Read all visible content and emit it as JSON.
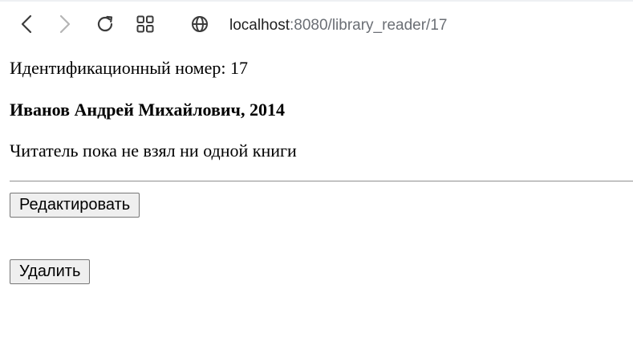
{
  "browser": {
    "url_host": "localhost",
    "url_path": ":8080/library_reader/17"
  },
  "page": {
    "id_line": "Идентификационный номер: 17",
    "reader_line": "Иванов Андрей Михайлович, 2014",
    "books_line": "Читатель пока не взял ни одной книги",
    "edit_label": "Редактировать",
    "delete_label": "Удалить"
  }
}
